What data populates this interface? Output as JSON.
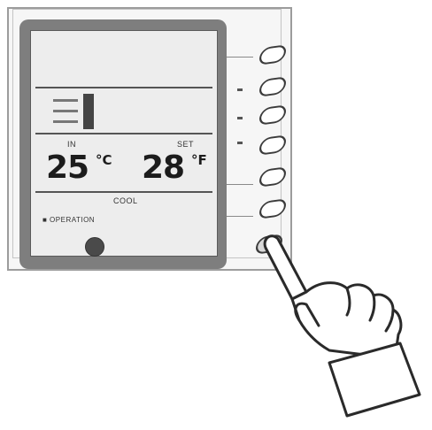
{
  "display": {
    "indoor_label": "IN",
    "indoor_temp": "25",
    "indoor_unit": "°C",
    "set_label": "SET",
    "set_temp": "28",
    "set_unit": "°F",
    "mode_text": "COOL",
    "status_text": "■ OPERATION"
  },
  "buttons": [
    {
      "name": "button-1"
    },
    {
      "name": "button-2"
    },
    {
      "name": "button-3"
    },
    {
      "name": "button-4"
    },
    {
      "name": "button-5"
    },
    {
      "name": "button-6"
    },
    {
      "name": "button-7"
    }
  ],
  "colors": {
    "panel": "#f6f6f6",
    "bezel": "#7e7e7e",
    "screen": "#ededed",
    "ink": "#1c1c1c"
  }
}
